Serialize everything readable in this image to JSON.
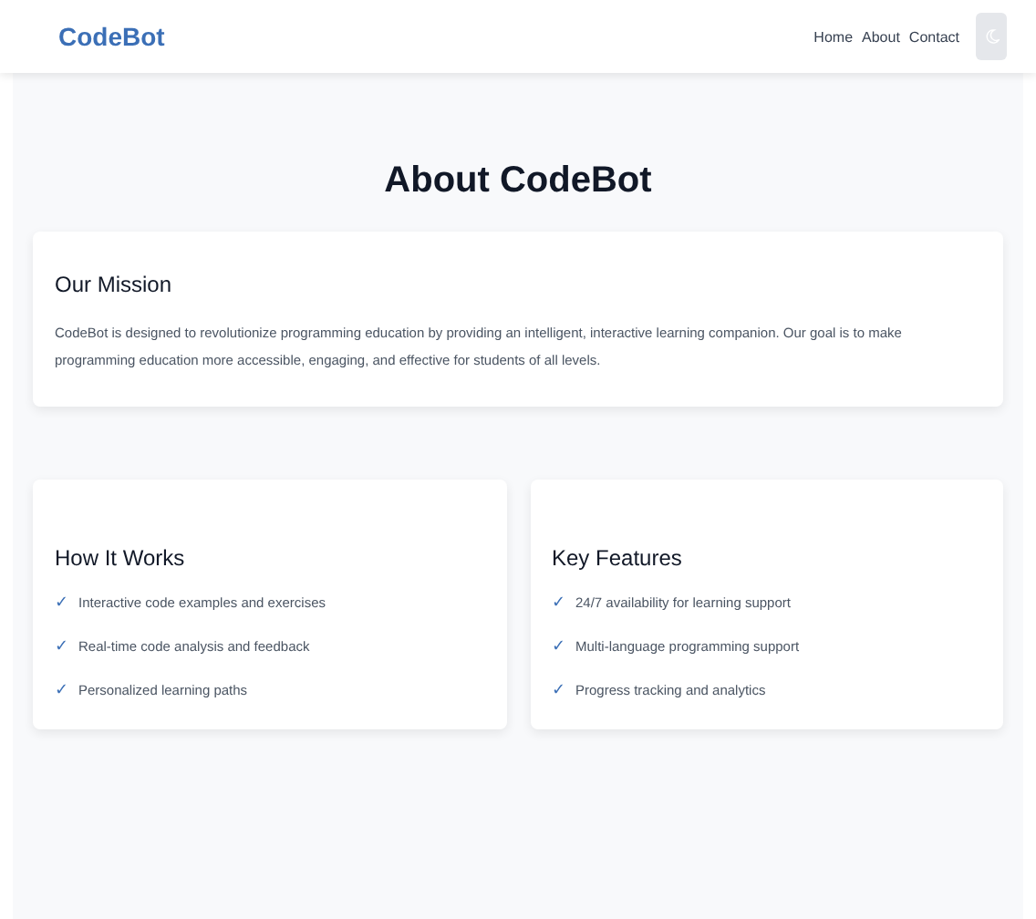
{
  "header": {
    "brand": "CodeBot",
    "nav": [
      {
        "label": "Home"
      },
      {
        "label": "About"
      },
      {
        "label": "Contact"
      }
    ]
  },
  "title": "About CodeBot",
  "mission": {
    "heading": "Our Mission",
    "text": "CodeBot is designed to revolutionize programming education by providing an intelligent, interactive learning companion. Our goal is to make programming education more accessible, engaging, and effective for students of all levels."
  },
  "cards": [
    {
      "heading": "How It Works",
      "items": [
        {
          "mark": "✓",
          "text": "Interactive code examples and exercises"
        },
        {
          "mark": "✓",
          "text": "Real-time code analysis and feedback"
        },
        {
          "mark": "✓",
          "text": "Personalized learning paths"
        }
      ]
    },
    {
      "heading": "Key Features",
      "items": [
        {
          "mark": "✓",
          "text": "24/7 availability for learning support"
        },
        {
          "mark": "✓",
          "text": "Multi-language programming support"
        },
        {
          "mark": "✓",
          "text": "Progress tracking and analytics"
        }
      ]
    }
  ]
}
